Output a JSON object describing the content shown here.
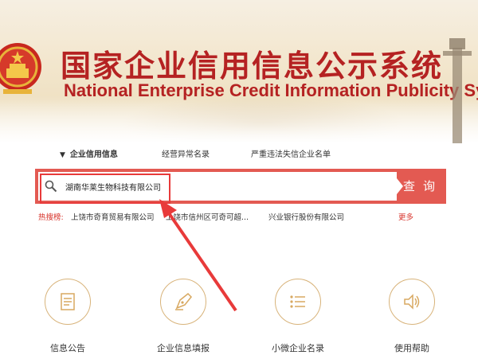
{
  "header": {
    "title_cn": "国家企业信用信息公示系统",
    "title_en": "National Enterprise Credit Information Publicity System"
  },
  "tabs": [
    {
      "label": "企业信用信息",
      "active": true
    },
    {
      "label": "经营异常名录",
      "active": false
    },
    {
      "label": "严重违法失信企业名单",
      "active": false
    }
  ],
  "search": {
    "value": "湖南华莱生物科技有限公司",
    "button_label": "查询",
    "accent_color": "#e35a52"
  },
  "hot_search": {
    "label": "热搜榜:",
    "items": [
      "上饶市奇育贸易有限公司",
      "上饶市信州区可奇可超...",
      "兴业银行股份有限公司"
    ],
    "more": "更多"
  },
  "features": [
    {
      "label": "信息公告",
      "icon": "document-icon"
    },
    {
      "label": "企业信息填报",
      "icon": "pen-icon"
    },
    {
      "label": "小微企业名录",
      "icon": "list-icon"
    },
    {
      "label": "使用帮助",
      "icon": "speaker-icon"
    }
  ]
}
